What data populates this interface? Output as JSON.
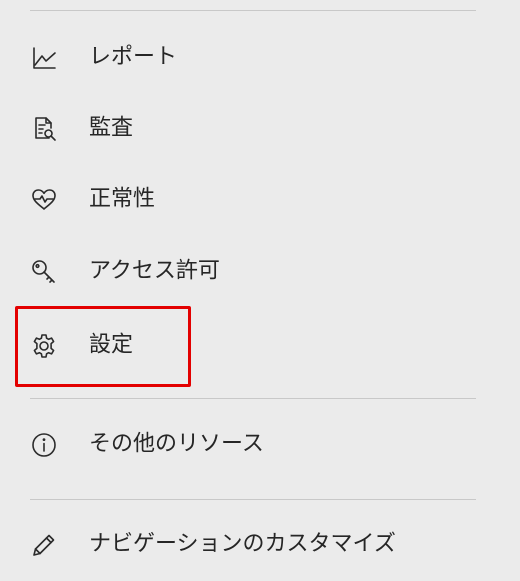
{
  "menu": {
    "items": [
      {
        "id": "report",
        "label": "レポート",
        "icon": "line-chart-icon"
      },
      {
        "id": "audit",
        "label": "監査",
        "icon": "document-search-icon"
      },
      {
        "id": "health",
        "label": "正常性",
        "icon": "heart-pulse-icon"
      },
      {
        "id": "access",
        "label": "アクセス許可",
        "icon": "key-icon"
      },
      {
        "id": "settings",
        "label": "設定",
        "icon": "gear-icon"
      },
      {
        "id": "other-resources",
        "label": "その他のリソース",
        "icon": "info-icon"
      },
      {
        "id": "customize-nav",
        "label": "ナビゲーションのカスタマイズ",
        "icon": "pencil-icon"
      }
    ],
    "highlighted_item": "settings",
    "highlight_color": "#e30000"
  }
}
